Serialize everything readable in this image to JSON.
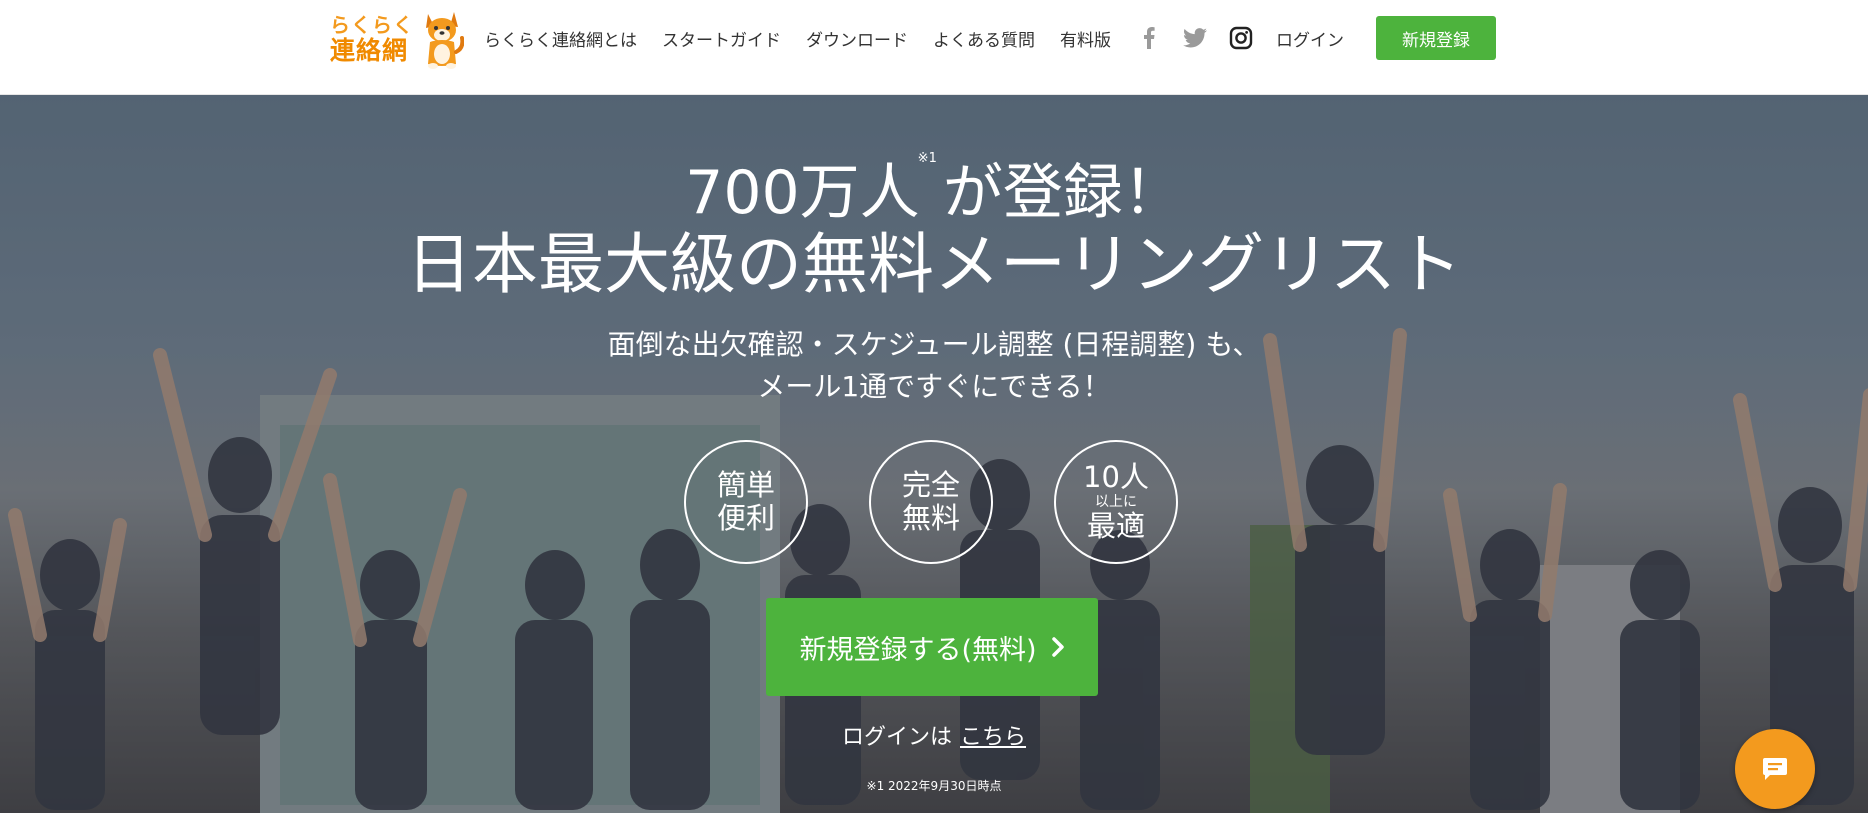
{
  "brand": {
    "line1": "らくらく",
    "line2": "連絡網"
  },
  "nav": {
    "items": [
      "らくらく連絡網とは",
      "スタートガイド",
      "ダウンロード",
      "よくある質問",
      "有料版"
    ],
    "login": "ログイン",
    "signup": "新規登録",
    "social_icons": [
      "facebook-icon",
      "twitter-icon",
      "instagram-icon"
    ]
  },
  "hero": {
    "headline_main": "700万人",
    "headline_sup": "※1",
    "headline_tail": "が登録！",
    "headline_line2": "日本最大級の無料メーリングリスト",
    "sub_line1": "面倒な出欠確認・スケジュール調整 (日程調整) も、",
    "sub_line2": "メール1通ですぐにできる！",
    "badges": [
      {
        "line1": "簡単",
        "line2": "便利"
      },
      {
        "line1": "完全",
        "line2": "無料"
      },
      {
        "line1": "10人",
        "small": "以上に",
        "line2": "最適"
      }
    ],
    "cta": "新規登録する(無料)",
    "login_prefix": "ログインは",
    "login_link": "こちら",
    "footnote": "※1 2022年9月30日時点"
  },
  "colors": {
    "accent_green": "#4db33d",
    "brand_orange": "#f39a1e"
  }
}
